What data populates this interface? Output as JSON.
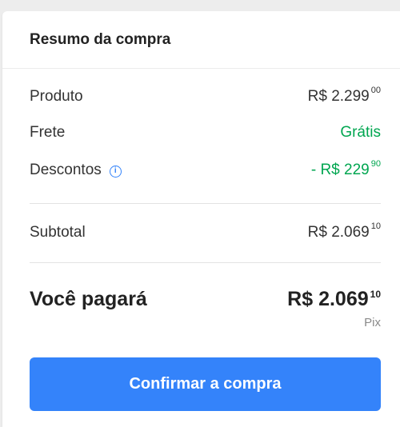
{
  "summary": {
    "title": "Resumo da compra",
    "product": {
      "label": "Produto",
      "currency": "R$",
      "amount": "2.299",
      "cents": "00"
    },
    "shipping": {
      "label": "Frete",
      "value": "Grátis"
    },
    "discounts": {
      "label": "Descontos",
      "prefix": "- R$",
      "amount": "229",
      "cents": "90",
      "icon": "info-icon"
    },
    "subtotal": {
      "label": "Subtotal",
      "currency": "R$",
      "amount": "2.069",
      "cents": "10"
    },
    "total": {
      "label": "Você pagará",
      "currency": "R$",
      "amount": "2.069",
      "cents": "10",
      "method": "Pix"
    },
    "confirm_label": "Confirmar a compra"
  },
  "colors": {
    "accent": "#3483fa",
    "positive": "#00a650",
    "text": "#333333",
    "muted": "#8a8a8a"
  }
}
